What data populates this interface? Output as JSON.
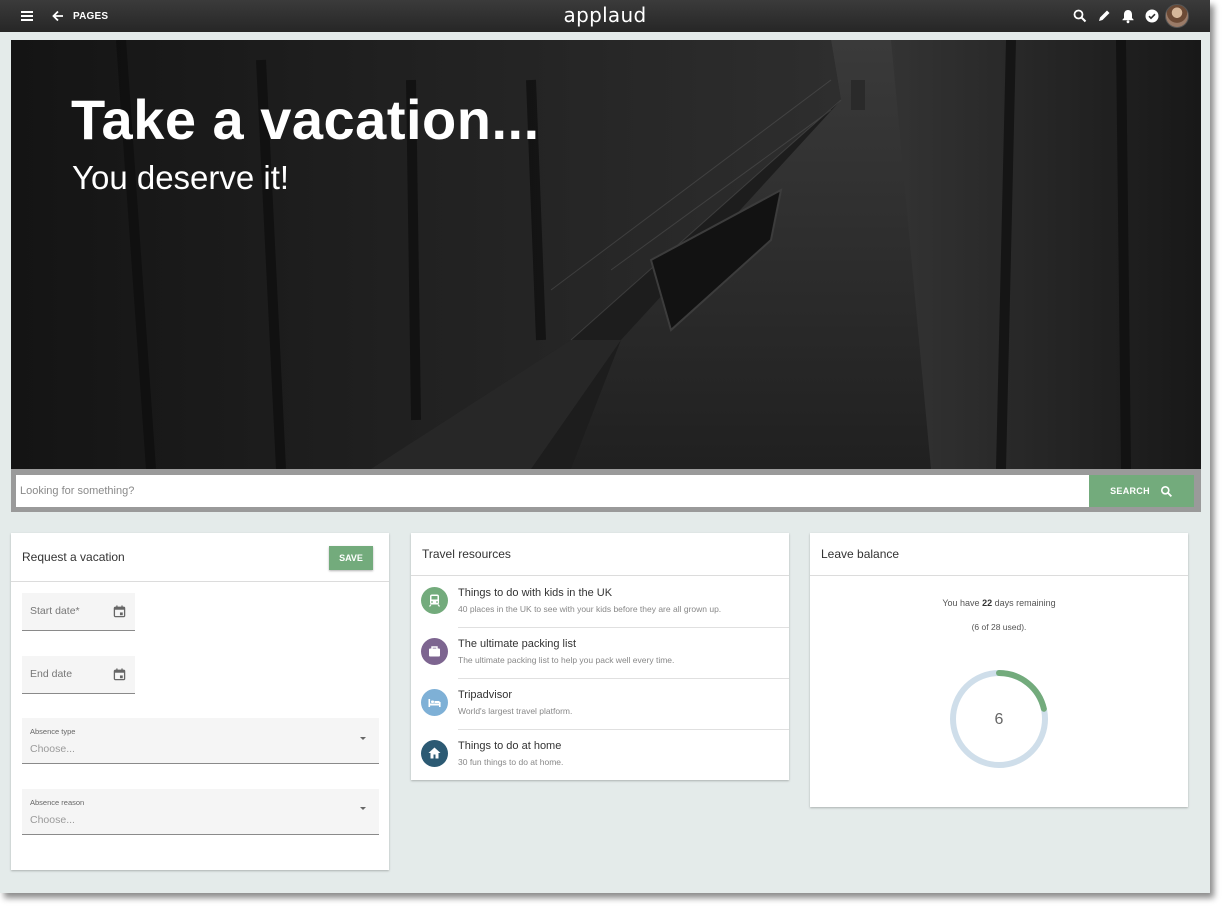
{
  "topbar": {
    "back_label": "PAGES",
    "app_name": "applaud",
    "icons": [
      "search-icon",
      "edit-icon",
      "bell-icon",
      "check-circle-icon",
      "avatar"
    ]
  },
  "hero": {
    "title": "Take a vacation...",
    "subtitle": "You deserve it!"
  },
  "search": {
    "placeholder": "Looking for something?",
    "button_label": "SEARCH"
  },
  "vacation_request": {
    "title": "Request a vacation",
    "save_label": "SAVE",
    "start_date_placeholder": "Start date*",
    "end_date_placeholder": "End date",
    "absence_type_label": "Absence type",
    "absence_type_value": "Choose...",
    "absence_reason_label": "Absence reason",
    "absence_reason_value": "Choose..."
  },
  "travel_resources": {
    "title": "Travel resources",
    "items": [
      {
        "title": "Things to do with kids in the UK",
        "description": "40 places in the UK to see with your kids before they are all grown up.",
        "icon": "train-icon",
        "color": "#73ab7c"
      },
      {
        "title": "The ultimate packing list",
        "description": "The ultimate packing list to help you pack well every time.",
        "icon": "suitcase-icon",
        "color": "#7d6590"
      },
      {
        "title": "Tripadvisor",
        "description": "World's largest travel platform.",
        "icon": "bed-icon",
        "color": "#7eb0d6"
      },
      {
        "title": "Things to do at home",
        "description": "30 fun things to do at home.",
        "icon": "home-icon",
        "color": "#2c5a73"
      }
    ]
  },
  "leave_balance": {
    "title": "Leave balance",
    "text_before": "You have ",
    "days_remaining": "22",
    "text_after": " days remaining",
    "used_text": "(6 of 28 used).",
    "used": 6,
    "total": 28,
    "ring_color": "#cfdeea",
    "progress_color": "#73ab7c"
  },
  "colors": {
    "accent": "#73ab7c",
    "background": "#e4ebea",
    "topbar": "#2f2f2f"
  }
}
